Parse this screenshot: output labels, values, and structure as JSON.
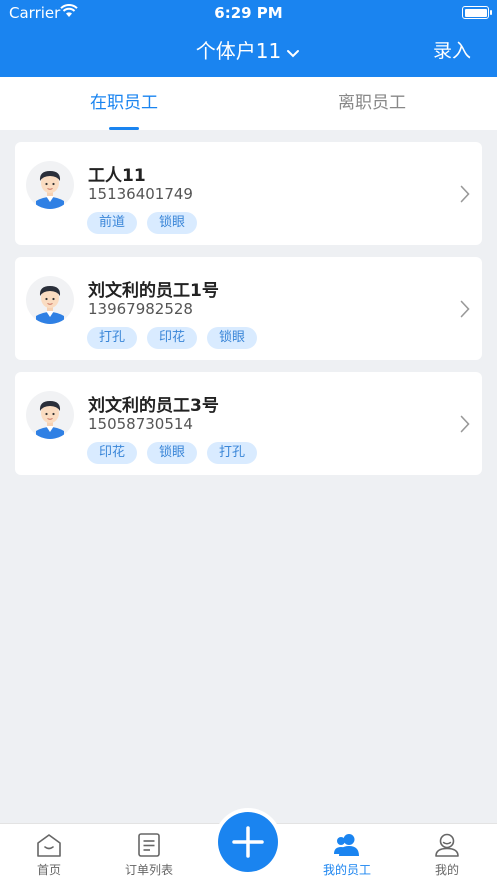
{
  "status_bar": {
    "carrier": "Carrier",
    "time": "6:29 PM"
  },
  "nav": {
    "title": "个体户11",
    "action": "录入"
  },
  "tabs": [
    {
      "label": "在职员工",
      "active": true
    },
    {
      "label": "离职员工",
      "active": false
    }
  ],
  "employees": [
    {
      "name": "工人11",
      "phone": "15136401749",
      "tags": [
        "前道",
        "锁眼"
      ]
    },
    {
      "name": "刘文利的员工1号",
      "phone": "13967982528",
      "tags": [
        "打孔",
        "印花",
        "锁眼"
      ]
    },
    {
      "name": "刘文利的员工3号",
      "phone": "15058730514",
      "tags": [
        "印花",
        "锁眼",
        "打孔"
      ]
    }
  ],
  "tab_bar": {
    "items": [
      {
        "label": "首页",
        "icon": "home-icon"
      },
      {
        "label": "订单列表",
        "icon": "document-list-icon"
      },
      {
        "label": "我的员工",
        "icon": "users-icon",
        "active": true
      },
      {
        "label": "我的",
        "icon": "user-icon"
      }
    ],
    "add_icon": "plus-icon"
  },
  "colors": {
    "primary": "#1a84f0",
    "tag_bg": "#d9ebff",
    "tag_text": "#3a86d8",
    "background": "#eef0f3"
  }
}
